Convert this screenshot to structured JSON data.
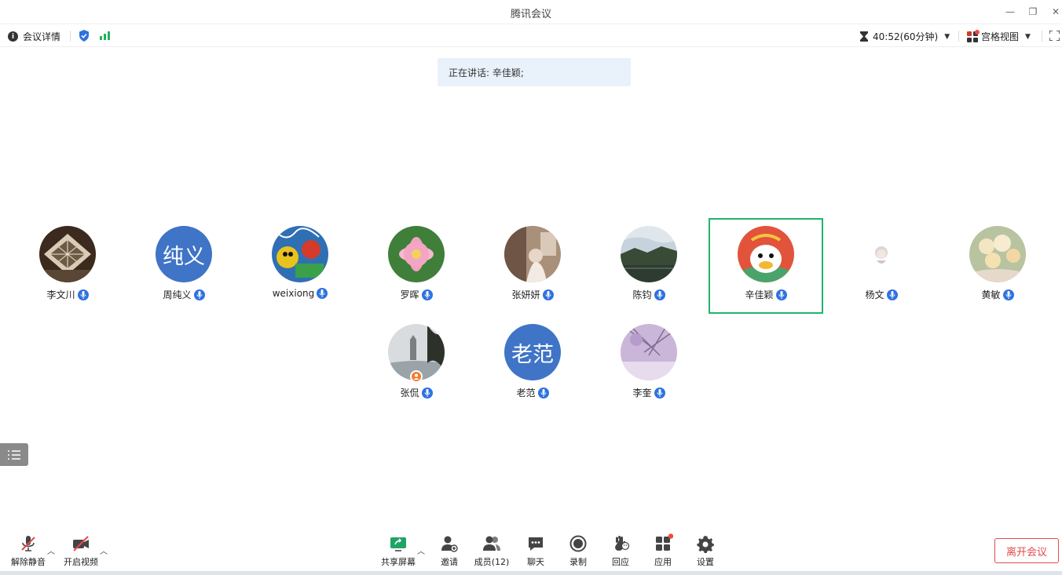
{
  "window": {
    "title": "腾讯会议",
    "minimize": "—",
    "restore": "❐",
    "close": "✕"
  },
  "infobar": {
    "meeting_details": "会议详情",
    "timer": "40:52(60分钟)",
    "view_mode": "宫格视图"
  },
  "speaker_banner": "正在讲话: 辛佳颖;",
  "participants": [
    {
      "name": "李文川",
      "avatar": "photo-diamond-ceiling"
    },
    {
      "name": "周纯义",
      "avatar_text": "纯义"
    },
    {
      "name": "weixiong",
      "avatar": "photo-colorful-drawing"
    },
    {
      "name": "罗晖",
      "avatar": "photo-lotus"
    },
    {
      "name": "张妍妍",
      "avatar": "photo-girl-indoor"
    },
    {
      "name": "陈钧",
      "avatar": "photo-lake"
    },
    {
      "name": "辛佳颖",
      "avatar": "cartoon-duck",
      "speaking": true
    },
    {
      "name": "杨文",
      "avatar": "small-anime-figure"
    },
    {
      "name": "黄敏",
      "avatar": "photo-flowers"
    },
    {
      "name": "张侃",
      "avatar": "photo-pagoda",
      "host": true
    },
    {
      "name": "老范",
      "avatar_text": "老范"
    },
    {
      "name": "李奎",
      "avatar": "photo-purple-branches"
    }
  ],
  "toolbar": {
    "unmute": "解除静音",
    "start_video": "开启视频",
    "share_screen": "共享屏幕",
    "invite": "邀请",
    "members": "成员(12)",
    "chat": "聊天",
    "record": "录制",
    "reactions": "回应",
    "apps": "应用",
    "settings": "设置",
    "leave": "离开会议"
  },
  "colors": {
    "accent_blue": "#2f72e0",
    "avatar_blue": "#3f74c6",
    "active_border": "#23b36b",
    "leave_red": "#e24a4a",
    "banner_bg": "#e9f1fb"
  }
}
